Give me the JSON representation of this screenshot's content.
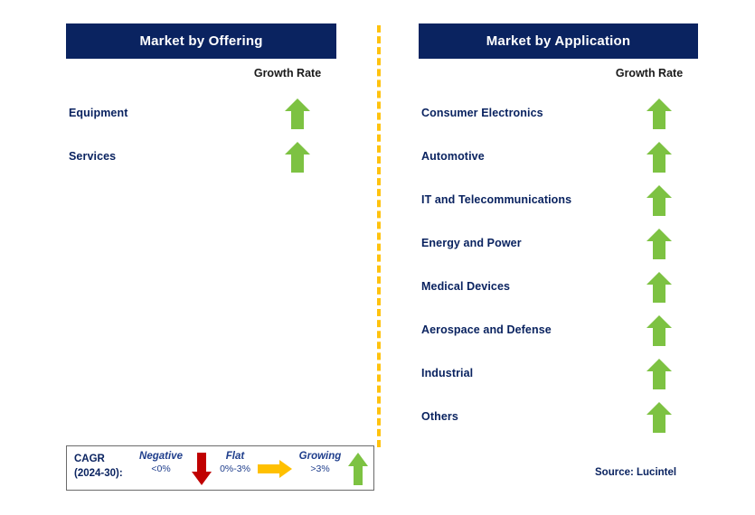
{
  "colors": {
    "header_navy": "#0a2360",
    "label_navy": "#0a2360",
    "arrow_green": "#7DC242",
    "arrow_red": "#C00000",
    "arrow_orange": "#FFC000",
    "divider_orange": "#FFC20E",
    "legend_text_blue": "#1F3E8C",
    "legend_border": "#6b6b6b",
    "background": "#ffffff"
  },
  "left_panel": {
    "title": "Market by Offering",
    "growth_rate_header": "Growth Rate",
    "rows": [
      {
        "label": "Equipment",
        "trend": "growing",
        "arrow_icon": "arrow-up-icon"
      },
      {
        "label": "Services",
        "trend": "growing",
        "arrow_icon": "arrow-up-icon"
      }
    ]
  },
  "right_panel": {
    "title": "Market by Application",
    "growth_rate_header": "Growth Rate",
    "rows": [
      {
        "label": "Consumer Electronics",
        "trend": "growing",
        "arrow_icon": "arrow-up-icon"
      },
      {
        "label": "Automotive",
        "trend": "growing",
        "arrow_icon": "arrow-up-icon"
      },
      {
        "label": "IT and Telecommunications",
        "trend": "growing",
        "arrow_icon": "arrow-up-icon"
      },
      {
        "label": "Energy and Power",
        "trend": "growing",
        "arrow_icon": "arrow-up-icon"
      },
      {
        "label": "Medical Devices",
        "trend": "growing",
        "arrow_icon": "arrow-up-icon"
      },
      {
        "label": "Aerospace and Defense",
        "trend": "growing",
        "arrow_icon": "arrow-up-icon"
      },
      {
        "label": "Industrial",
        "trend": "growing",
        "arrow_icon": "arrow-up-icon"
      },
      {
        "label": "Others",
        "trend": "growing",
        "arrow_icon": "arrow-up-icon"
      }
    ]
  },
  "legend": {
    "title_line1": "CAGR",
    "title_line2": "(2024-30):",
    "items": [
      {
        "word": "Negative",
        "range": "<0%",
        "arrow_icon": "arrow-down-icon",
        "color": "#C00000"
      },
      {
        "word": "Flat",
        "range": "0%-3%",
        "arrow_icon": "arrow-right-icon",
        "color": "#FFC000"
      },
      {
        "word": "Growing",
        "range": ">3%",
        "arrow_icon": "arrow-up-icon",
        "color": "#7DC242"
      }
    ]
  },
  "source": "Source: Lucintel",
  "divider": {
    "style": "dashed-vertical",
    "color": "#FFC20E"
  }
}
